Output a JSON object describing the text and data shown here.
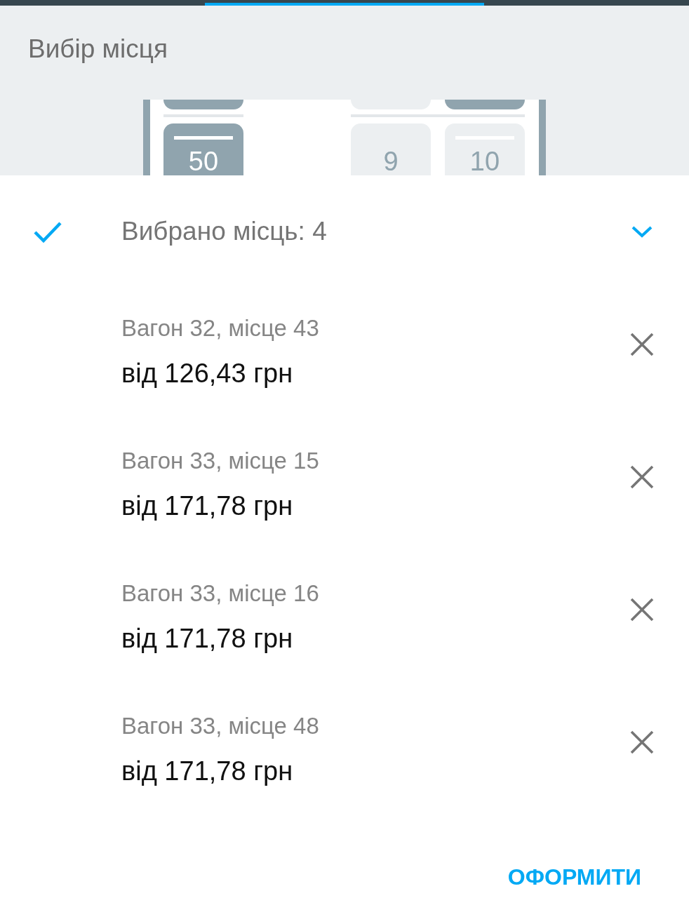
{
  "header": {
    "title": "Вибір місця"
  },
  "seat_map": {
    "rows": [
      {
        "left": [
          {
            "occupied": true
          }
        ],
        "right": [
          {
            "occupied": false
          },
          {
            "occupied": true
          }
        ]
      },
      {
        "left": [
          {
            "number": "50",
            "occupied": true,
            "marked": true
          }
        ],
        "right": [
          {
            "number": "9",
            "occupied": false,
            "marked": false
          },
          {
            "number": "10",
            "occupied": false,
            "marked": true
          }
        ]
      }
    ]
  },
  "selection": {
    "summary": "Вибрано місць: 4",
    "expanded": true,
    "items": [
      {
        "seat": "Вагон 32, місце 43",
        "price": "від 126,43 грн"
      },
      {
        "seat": "Вагон 33, місце 15",
        "price": "від 171,78 грн"
      },
      {
        "seat": "Вагон 33, місце 16",
        "price": "від 171,78 грн"
      },
      {
        "seat": "Вагон 33, місце 48",
        "price": "від 171,78 грн"
      }
    ]
  },
  "checkout_button": "ОФОРМИТИ"
}
